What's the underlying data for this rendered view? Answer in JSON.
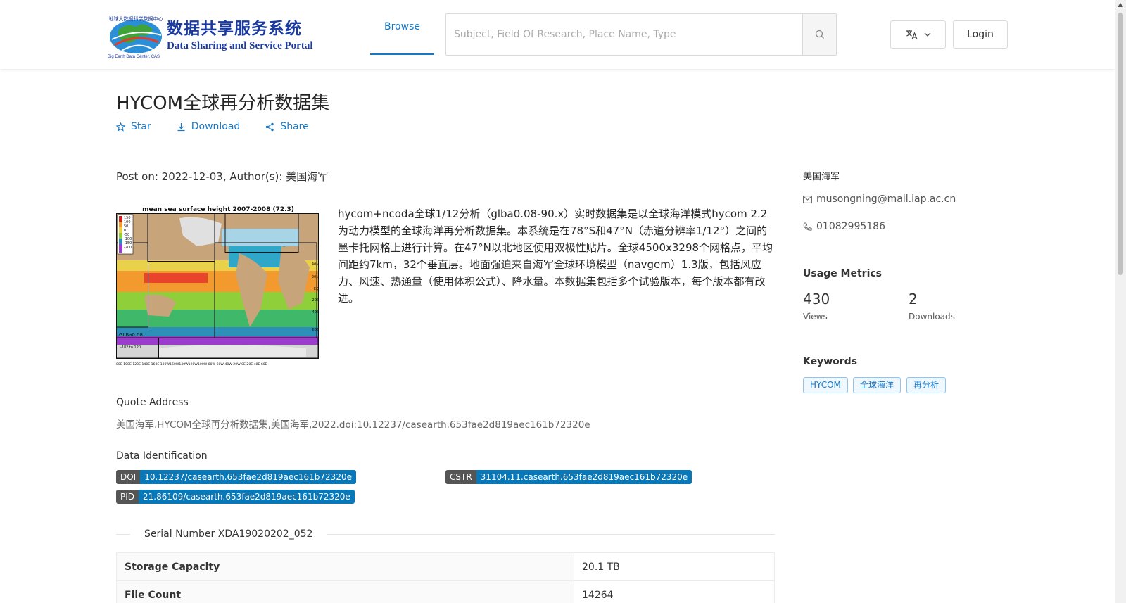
{
  "header": {
    "logo": {
      "title_cn": "数据共享服务系统",
      "title_en": "Data Sharing and Service Portal",
      "subtitle_small": "Big Earth Data Center, CAS",
      "globe_caption": "地球大数据科学数据中心"
    },
    "nav_browse": "Browse",
    "search_placeholder": "Subject, Field Of Research, Place Name, Type",
    "login": "Login"
  },
  "dataset": {
    "title": "HYCOM全球再分析数据集",
    "actions": {
      "star": "Star",
      "download": "Download",
      "share": "Share"
    },
    "post_info": "Post on: 2022-12-03, Author(s): 美国海军",
    "description": "hycom+ncoda全球1/12分析（glba0.08-90.x）实时数据集是以全球海洋模式hycom 2.2为动力模型的全球海洋再分析数据集。本系统是在78°S和47°N（赤道分辨率1/12°）之间的墨卡托网格上进行计算。在47°N以北地区使用双极性贴片。全球4500x3298个网格点，平均间距约7km，32个垂直层。地面强迫来自海军全球环境模型（navgem）1.3版，包括风应力、风速、热通量（使用体积公式）、降水量。本数据集包括多个试验版本，每个版本都有改进。",
    "map_image": {
      "title": "mean sea surface height 2007-2008 (72.3)",
      "legend_ticks": [
        "150",
        "100",
        "50",
        "0",
        "-50",
        "-100",
        "-150",
        "-200"
      ],
      "lat_ticks": [
        "40N",
        "20N",
        "EQ",
        "20S",
        "40S",
        "60S"
      ],
      "lon_ticks": "80E 100E 120E 140E 160E 180W160W140W120W100W 80W 60W 40W 20W 0E 20E 40E 60E",
      "label1": "GLBa0.08",
      "label2": "-182 to 120"
    },
    "quote": {
      "label": "Quote Address",
      "text": "美国海军.HYCOM全球再分析数据集,美国海军,2022.doi:10.12237/casearth.653fae2d819aec161b72320e"
    },
    "identification": {
      "label": "Data Identification",
      "doi_key": "DOI",
      "doi": "10.12237/casearth.653fae2d819aec161b72320e",
      "cstr_key": "CSTR",
      "cstr": "31104.11.casearth.653fae2d819aec161b72320e",
      "pid_key": "PID",
      "pid": "21.86109/casearth.653fae2d819aec161b72320e"
    },
    "serial": "Serial Number XDA19020202_052",
    "table": [
      {
        "key": "Storage Capacity",
        "value": "20.1 TB"
      },
      {
        "key": "File Count",
        "value": "14264"
      }
    ]
  },
  "sidebar": {
    "author": "美国海军",
    "email": "musongning@mail.iap.ac.cn",
    "phone": "01082995186",
    "metrics_heading": "Usage Metrics",
    "views": "430",
    "views_label": "Views",
    "downloads": "2",
    "downloads_label": "Downloads",
    "keywords_heading": "Keywords",
    "keywords": [
      "HYCOM",
      "全球海洋",
      "再分析"
    ]
  }
}
